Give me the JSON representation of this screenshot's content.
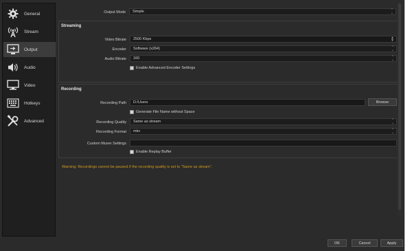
{
  "sidebar": {
    "items": [
      {
        "label": "General",
        "icon": "gear-icon"
      },
      {
        "label": "Stream",
        "icon": "antenna-icon"
      },
      {
        "label": "Output",
        "icon": "monitor-output-icon"
      },
      {
        "label": "Audio",
        "icon": "speaker-icon"
      },
      {
        "label": "Video",
        "icon": "display-icon"
      },
      {
        "label": "Hotkeys",
        "icon": "keyboard-icon"
      },
      {
        "label": "Advanced",
        "icon": "tools-icon"
      }
    ],
    "active": "Output"
  },
  "output_mode": {
    "label": "Output Mode",
    "value": "Simple"
  },
  "streaming": {
    "title": "Streaming",
    "video_bitrate": {
      "label": "Video Bitrate",
      "value": "2500 Kbps"
    },
    "encoder": {
      "label": "Encoder",
      "value": "Software (x264)"
    },
    "audio_bitrate": {
      "label": "Audio Bitrate",
      "value": "160"
    },
    "advanced_encoder": {
      "label": "Enable Advanced Encoder Settings",
      "checked": false
    }
  },
  "recording": {
    "title": "Recording",
    "path": {
      "label": "Recording Path",
      "value": "D:/Users"
    },
    "browse_label": "Browse",
    "no_space": {
      "label": "Generate File Name without Space",
      "checked": false
    },
    "quality": {
      "label": "Recording Quality",
      "value": "Same as stream"
    },
    "format": {
      "label": "Recording Format",
      "value": "mkv"
    },
    "muxer": {
      "label": "Custom Muxer Settings",
      "value": ""
    },
    "replay_buffer": {
      "label": "Enable Replay Buffer",
      "checked": false
    }
  },
  "warning": "Warning: Recordings cannot be paused if the recording quality is set to \"Same as stream\".",
  "buttons": {
    "ok": "OK",
    "cancel": "Cancel",
    "apply": "Apply"
  },
  "colors": {
    "background": "#2b2b2b",
    "sidebar": "#1f1f1f",
    "field": "#1c1c1c",
    "warning": "#d29a1e"
  }
}
